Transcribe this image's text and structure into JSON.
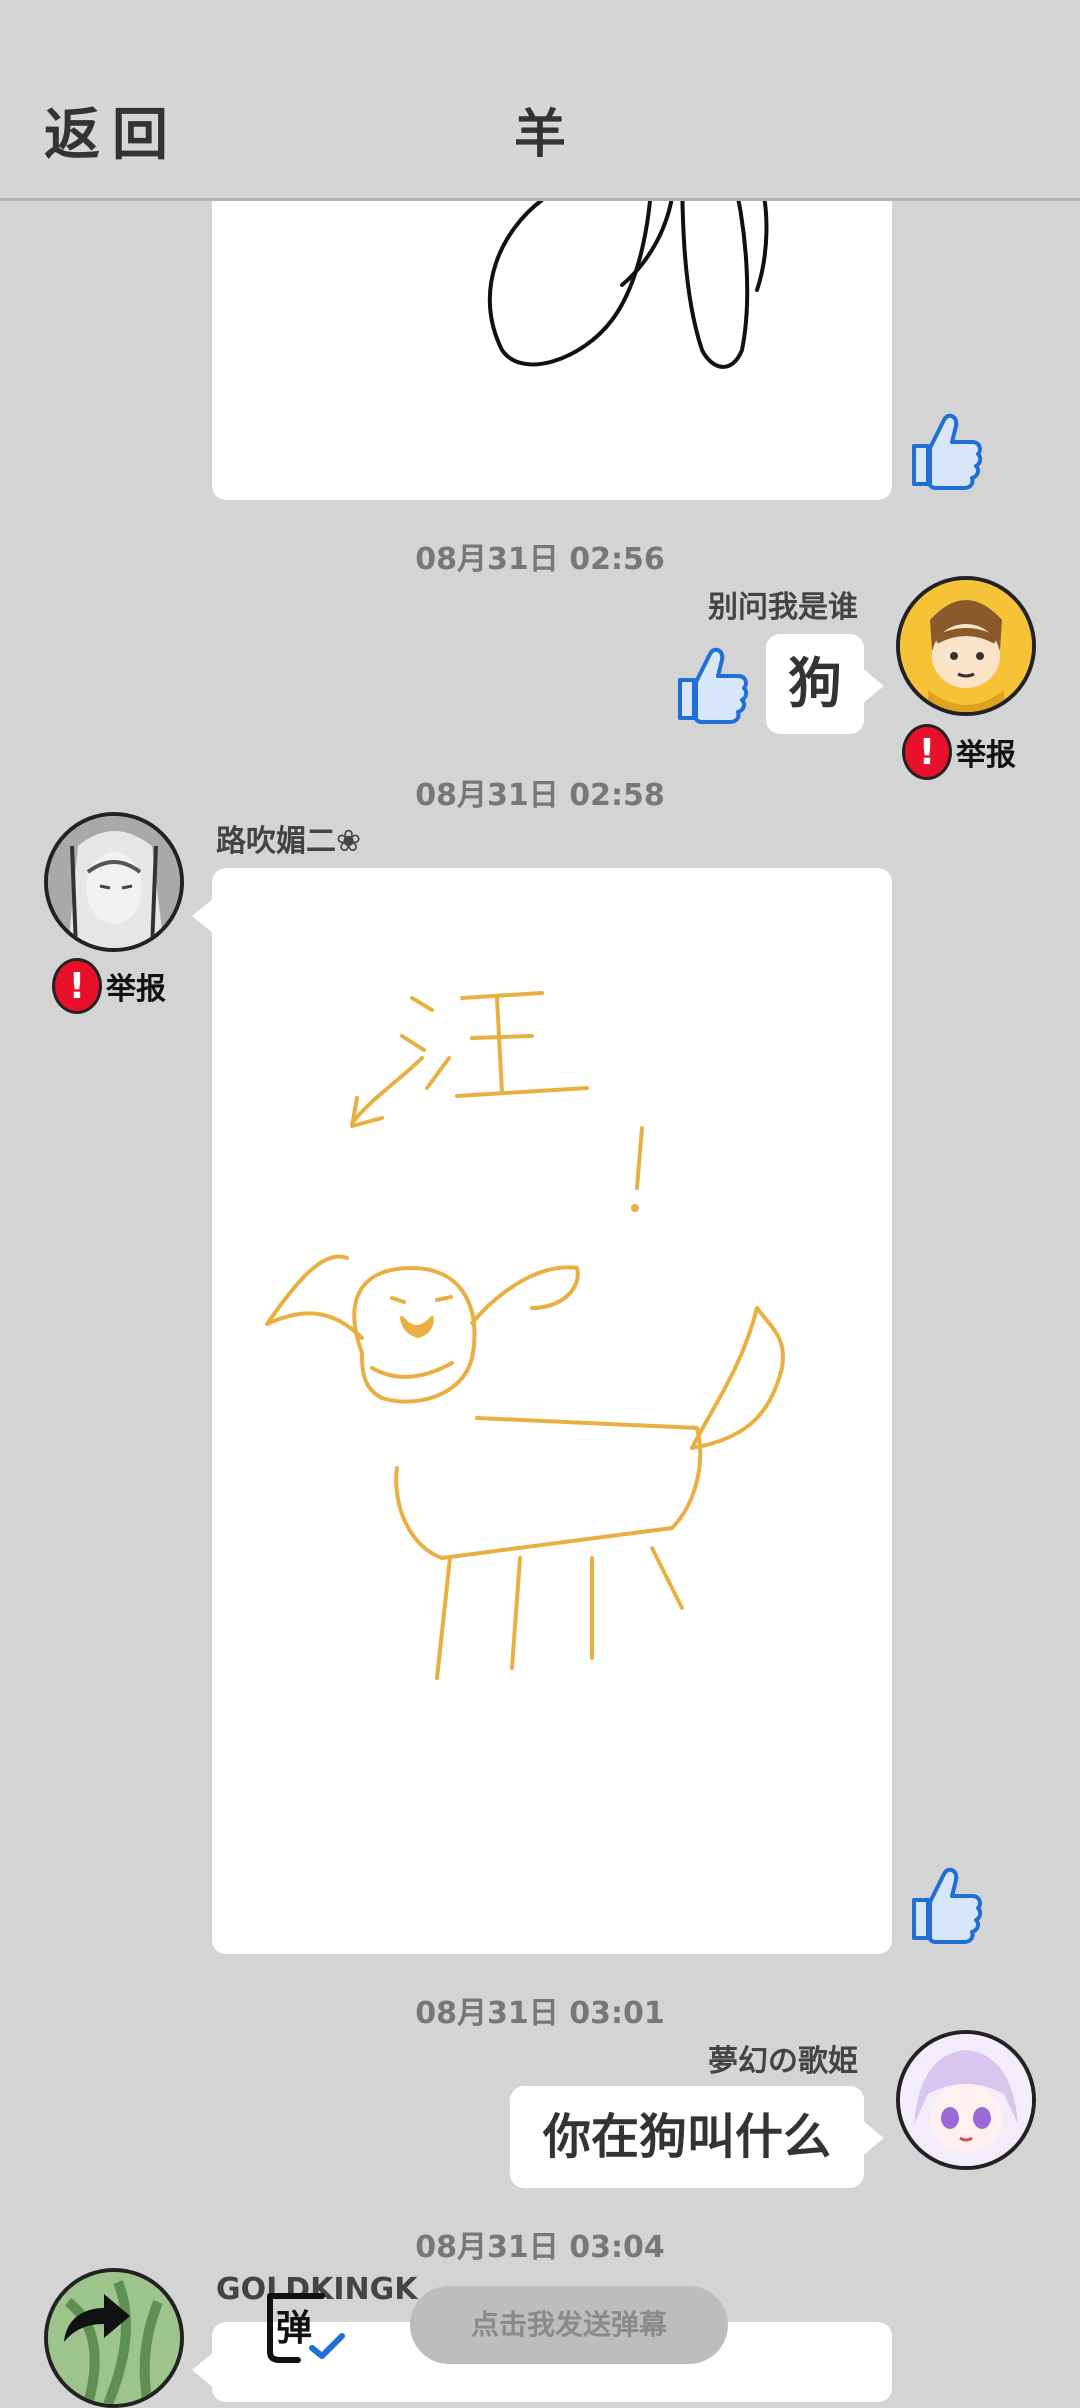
{
  "header": {
    "back_label": "返回",
    "title": "羊"
  },
  "messages": [
    {
      "timestamp": "08月31日  02:56",
      "username": "别问我是谁",
      "text": "狗",
      "report_label": "举报"
    },
    {
      "timestamp": "08月31日  02:58",
      "username": "路吹媚二❀",
      "report_label": "举报",
      "drawing_text": "←汪!"
    },
    {
      "timestamp": "08月31日  03:01",
      "username": "夢幻の歌姫",
      "text": "你在狗叫什么"
    },
    {
      "timestamp": "08月31日  03:04",
      "username": "GOLDKINGK"
    }
  ],
  "danmaku": {
    "icon_text": "弹",
    "placeholder": "点击我发送弹幕"
  },
  "colors": {
    "background": "#d4d4d4",
    "like": "#1f6fd6",
    "report": "#e8102a",
    "drawing": "#e8b040"
  }
}
